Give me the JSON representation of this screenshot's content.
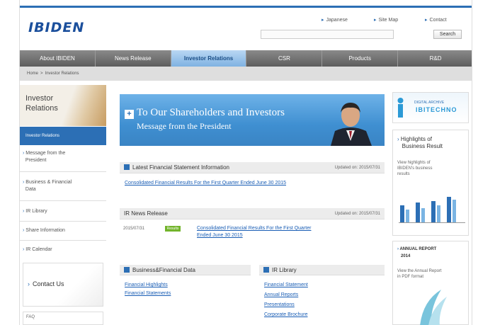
{
  "header": {
    "logo": "IBIDEN",
    "util_links": [
      "Japanese",
      "Site Map",
      "Contact"
    ],
    "search_button": "Search"
  },
  "gnav": {
    "items": [
      "About IBIDEN",
      "News Release",
      "Investor Relations",
      "CSR",
      "Products",
      "R&D"
    ],
    "active_index": 2
  },
  "breadcrumb": {
    "home": "Home",
    "current": "Investor Relations"
  },
  "sidebar": {
    "title_line1": "Investor",
    "title_line2": "Relations",
    "active": "Investor Relations",
    "links": [
      {
        "l1": "Message from the",
        "l2": "President"
      },
      {
        "l1": "Business & Financial",
        "l2": "Data"
      },
      {
        "l1": "IR Library",
        "l2": ""
      },
      {
        "l1": "Share Information",
        "l2": ""
      },
      {
        "l1": "IR Calendar",
        "l2": ""
      }
    ],
    "contact": "Contact Us",
    "bottom_text": "FAQ"
  },
  "banner": {
    "line1": "To Our Shareholders and Investors",
    "line2": "Message from the President"
  },
  "latest": {
    "title": "Latest Financial Statement Information",
    "updated": "Updated on: 2015/07/31",
    "link": "Consolidated Financial Results For the First Quarter Ended June 30 2015"
  },
  "news": {
    "title": "IR News Release",
    "updated": "Updated on: 2015/07/31",
    "date": "2015/07/31",
    "tag": "Results",
    "link_l1": "Consolidated Financial Results For the First Quarter",
    "link_l2": "Ended June 30 2015"
  },
  "bfd": {
    "title": "Business&Financial Data",
    "links": [
      "Financial Highlights",
      "Financial Statements"
    ]
  },
  "irlib": {
    "title": "IR Library",
    "links": [
      "Financial Statement",
      "Annual Reports",
      "Presentations",
      "Corporate Brochure"
    ]
  },
  "right": {
    "techno_l1": "DIGITAL ARCHIVE",
    "techno_l2": "IBITECHNO",
    "highlights_l1": "Highlights of",
    "highlights_l2": "Business Result",
    "highlights_text": [
      "View highlights of",
      "IBIDEN's business",
      "results"
    ],
    "annual_l1": "ANNUAL REPORT",
    "annual_l2": "2014",
    "annual_text": [
      "View the Annual Report",
      "in PDF format"
    ]
  },
  "colors": {
    "brand_blue": "#2c6fb5",
    "nav_gray": "#6e6e6e",
    "new_tag": "#72b42b"
  }
}
